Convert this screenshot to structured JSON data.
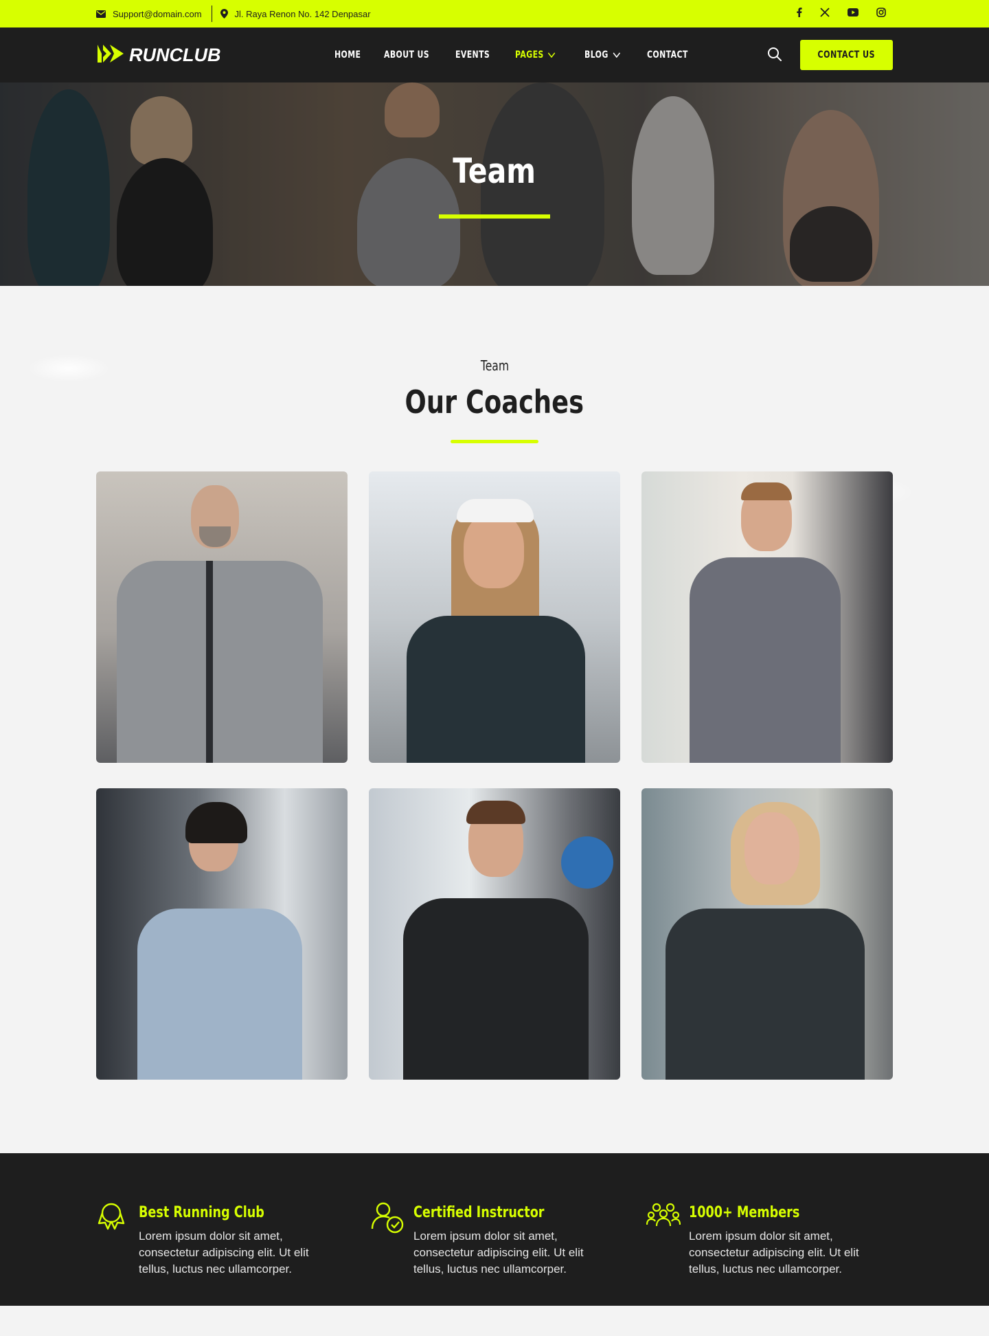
{
  "topbar": {
    "email": "Support@domain.com",
    "address": "Jl. Raya Renon No. 142 Denpasar",
    "social": [
      "facebook-icon",
      "x-icon",
      "youtube-icon",
      "instagram-icon"
    ]
  },
  "header": {
    "logo_text": "RUNCLUB",
    "nav": [
      {
        "label": "HOME"
      },
      {
        "label": "ABOUT US"
      },
      {
        "label": "EVENTS"
      },
      {
        "label": "PAGES",
        "active": true,
        "dropdown": true
      },
      {
        "label": "BLOG",
        "dropdown": true
      },
      {
        "label": "CONTACT"
      }
    ],
    "cta": "CONTACT US"
  },
  "hero": {
    "title": "Team"
  },
  "team": {
    "subtitle": "Team",
    "title": "Our Coaches"
  },
  "features": [
    {
      "icon": "award-icon",
      "title": "Best Running Club",
      "text": "Lorem ipsum dolor sit amet, consectetur adipiscing elit. Ut elit tellus, luctus nec ullamcorper."
    },
    {
      "icon": "certified-user-icon",
      "title": "Certified Instructor",
      "text": "Lorem ipsum dolor sit amet, consectetur adipiscing elit. Ut elit tellus, luctus nec ullamcorper."
    },
    {
      "icon": "group-icon",
      "title": "1000+ Members",
      "text": "Lorem ipsum dolor sit amet, consectetur adipiscing elit. Ut elit tellus, luctus nec ullamcorper."
    }
  ],
  "colors": {
    "accent": "#d7ff00",
    "dark": "#1e1e1e"
  }
}
